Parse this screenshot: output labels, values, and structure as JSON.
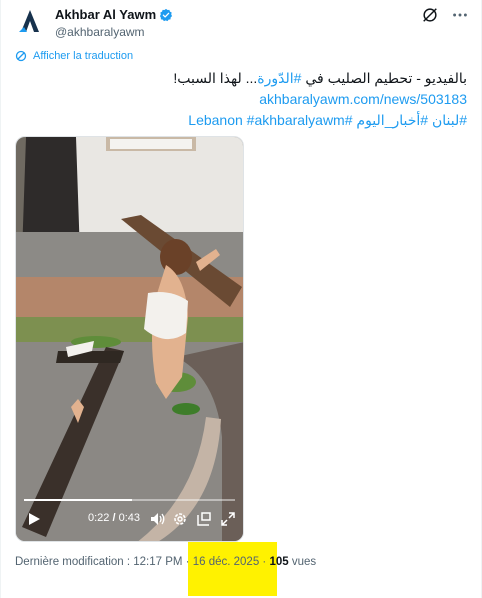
{
  "author": {
    "name": "Akhbar Al Yawm",
    "handle": "@akhbaralyawm"
  },
  "translate_label": "Afficher la traduction",
  "tweet": {
    "line1_prefix": "بالفيديو - تحطيم الصليب في ",
    "line1_hashtag": "#الدّورة",
    "line1_suffix": "... لهذا السبب!",
    "link": "akhbaralyawm.com/news/503183",
    "hashtags": "#لبنان #أخبار_اليوم #Lebanon #akhbaralyawm"
  },
  "video": {
    "time_current": "0:22",
    "time_total": "0:43",
    "progress": 0.51
  },
  "meta": {
    "modified_label": "Dernière modification : ",
    "time": "12:17 PM",
    "date": "16 déc. 2025",
    "views_count": "105",
    "views_label": "vues"
  },
  "colors": {
    "accent": "#1d9bf0",
    "highlight": "#fff200"
  },
  "icons": [
    "brand-logo-icon",
    "verified-badge-icon",
    "grok-icon",
    "more-icon",
    "translate-icon",
    "play-icon",
    "volume-icon",
    "settings-icon",
    "pip-icon",
    "fullscreen-icon"
  ]
}
